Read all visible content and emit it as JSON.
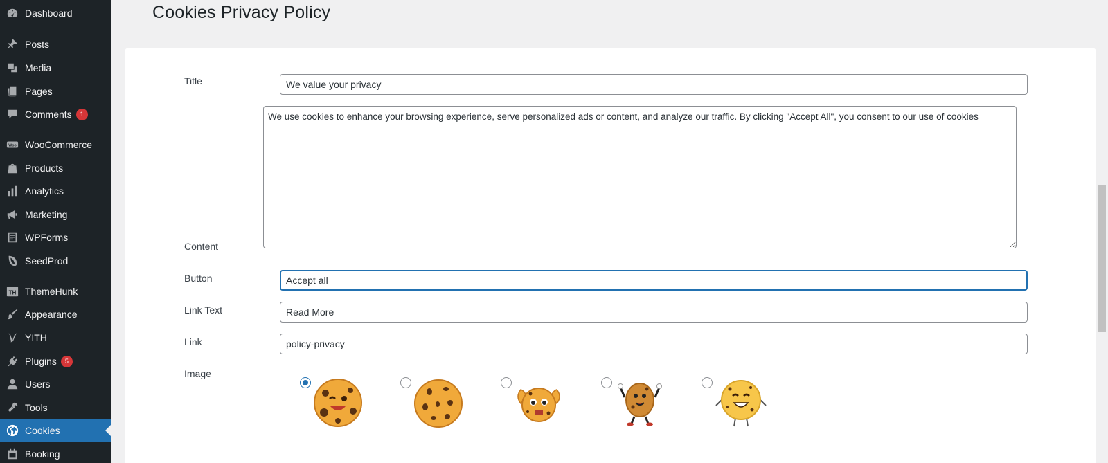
{
  "sidebar": {
    "items": [
      {
        "label": "Dashboard",
        "icon": "dashboard-icon"
      },
      {
        "label": "Posts",
        "icon": "pin-icon"
      },
      {
        "label": "Media",
        "icon": "media-icon"
      },
      {
        "label": "Pages",
        "icon": "pages-icon"
      },
      {
        "label": "Comments",
        "icon": "comments-icon",
        "badge": "1"
      },
      {
        "label": "WooCommerce",
        "icon": "woocommerce-icon"
      },
      {
        "label": "Products",
        "icon": "products-icon"
      },
      {
        "label": "Analytics",
        "icon": "analytics-icon"
      },
      {
        "label": "Marketing",
        "icon": "megaphone-icon"
      },
      {
        "label": "WPForms",
        "icon": "wpforms-icon"
      },
      {
        "label": "SeedProd",
        "icon": "seedprod-icon"
      },
      {
        "label": "ThemeHunk",
        "icon": "themehunk-icon"
      },
      {
        "label": "Appearance",
        "icon": "paintbrush-icon"
      },
      {
        "label": "YITH",
        "icon": "yith-icon"
      },
      {
        "label": "Plugins",
        "icon": "plugins-icon",
        "badge": "5"
      },
      {
        "label": "Users",
        "icon": "users-icon"
      },
      {
        "label": "Tools",
        "icon": "wrench-icon"
      },
      {
        "label": "Cookies",
        "icon": "globe-icon",
        "active": true
      },
      {
        "label": "Booking",
        "icon": "calendar-icon"
      }
    ]
  },
  "page": {
    "title": "Cookies Privacy Policy"
  },
  "form": {
    "title_label": "Title",
    "title_value": "We value your privacy",
    "content_label": "Content",
    "content_value": "We use cookies to enhance your browsing experience, serve personalized ads or content, and analyze our traffic. By clicking \"Accept All\", you consent to our use of cookies",
    "button_label": "Button",
    "button_value": "Accept all",
    "link_text_label": "Link Text",
    "link_text_value": "Read More",
    "link_label": "Link",
    "link_value": "policy-privacy",
    "image_label": "Image",
    "image_options": [
      {
        "name": "winking-cookie",
        "selected": true
      },
      {
        "name": "plain-cookie",
        "selected": false
      },
      {
        "name": "flexing-cookie",
        "selected": false
      },
      {
        "name": "dancing-cookie",
        "selected": false
      },
      {
        "name": "smiling-cookie",
        "selected": false
      }
    ]
  },
  "colors": {
    "sidebar_bg": "#1d2327",
    "active_bg": "#2271b1",
    "badge_bg": "#d63638",
    "cookie_base": "#f0a93a",
    "chip": "#5a3212"
  }
}
